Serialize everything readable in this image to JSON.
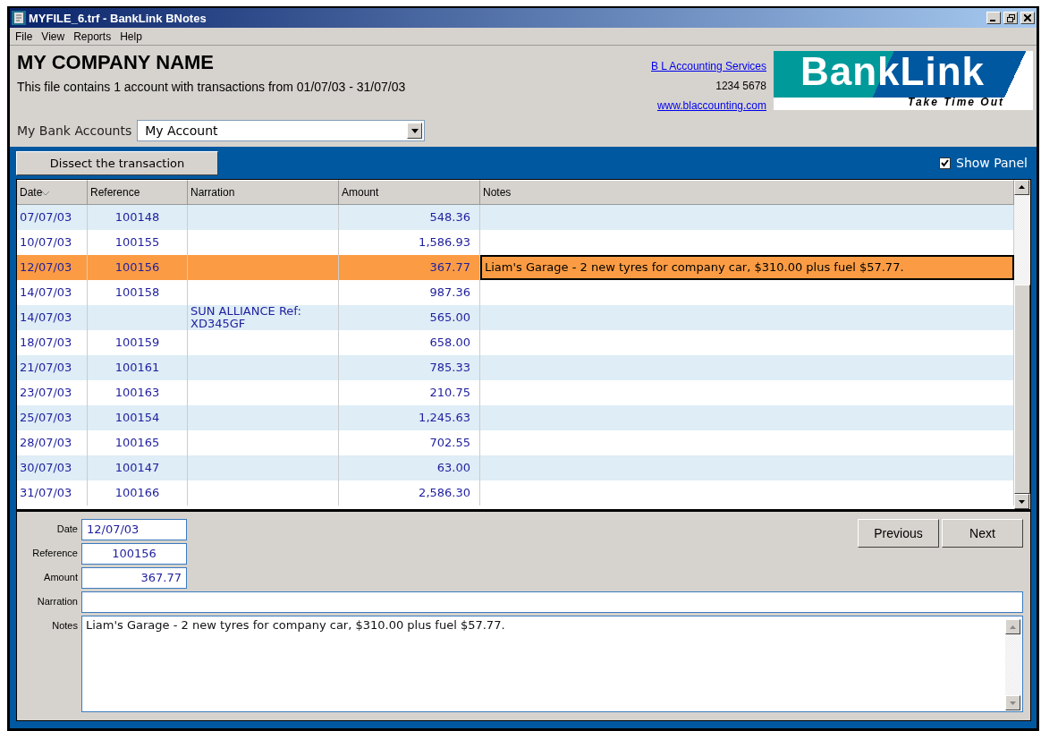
{
  "window": {
    "title": "MYFILE_6.trf - BankLink BNotes"
  },
  "menu": [
    "File",
    "View",
    "Reports",
    "Help"
  ],
  "header": {
    "company": "MY COMPANY NAME",
    "summary": "This file contains 1 account with transactions from 01/07/03 - 31/07/03",
    "accountant": {
      "name": "B L Accounting Services",
      "phone": "1234 5678",
      "website": "www.blaccounting.com"
    },
    "logo": {
      "brand": "BankLink",
      "tagline": "Take Time Out"
    }
  },
  "bank_accounts": {
    "label": "My Bank Accounts",
    "value": "My Account"
  },
  "toolbar": {
    "dissect_button": "Dissect the transaction",
    "show_panel": {
      "label": "Show Panel",
      "checked": true
    }
  },
  "table": {
    "columns": [
      "Date",
      "Reference",
      "Narration",
      "Amount",
      "Notes"
    ],
    "rows": [
      {
        "date": "07/07/03",
        "reference": "100148",
        "amount": "548.36",
        "selected": false
      },
      {
        "date": "10/07/03",
        "reference": "100155",
        "amount": "1,586.93",
        "selected": false
      },
      {
        "date": "12/07/03",
        "reference": "100156",
        "amount": "367.77",
        "notes": "Liam's Garage - 2 new tyres for company car, $310.00 plus fuel $57.77.",
        "selected": true
      },
      {
        "date": "14/07/03",
        "reference": "100158",
        "amount": "987.36",
        "selected": false
      },
      {
        "date": "14/07/03",
        "narration": "SUN ALLIANCE Ref: XD345GF",
        "amount": "565.00",
        "selected": false
      },
      {
        "date": "18/07/03",
        "reference": "100159",
        "amount": "658.00",
        "selected": false
      },
      {
        "date": "21/07/03",
        "reference": "100161",
        "amount": "785.33",
        "selected": false
      },
      {
        "date": "23/07/03",
        "reference": "100163",
        "amount": "210.75",
        "selected": false
      },
      {
        "date": "25/07/03",
        "reference": "100154",
        "amount": "1,245.63",
        "selected": false
      },
      {
        "date": "28/07/03",
        "reference": "100165",
        "amount": "702.55",
        "selected": false
      },
      {
        "date": "30/07/03",
        "reference": "100147",
        "amount": "63.00",
        "selected": false
      },
      {
        "date": "31/07/03",
        "reference": "100166",
        "amount": "2,586.30",
        "selected": false
      }
    ]
  },
  "detail": {
    "fields": [
      {
        "label": "Date",
        "value": "12/07/03",
        "kind": "date"
      },
      {
        "label": "Reference",
        "value": "100156",
        "kind": "reference"
      },
      {
        "label": "Amount",
        "value": "367.77",
        "kind": "amount"
      },
      {
        "label": "Narration",
        "kind": "text"
      },
      {
        "label": "Notes",
        "value": "Liam's Garage - 2 new tyres for company car, $310.00 plus fuel $57.77.",
        "kind": "memo"
      }
    ],
    "buttons": [
      "Previous",
      "Next"
    ]
  }
}
